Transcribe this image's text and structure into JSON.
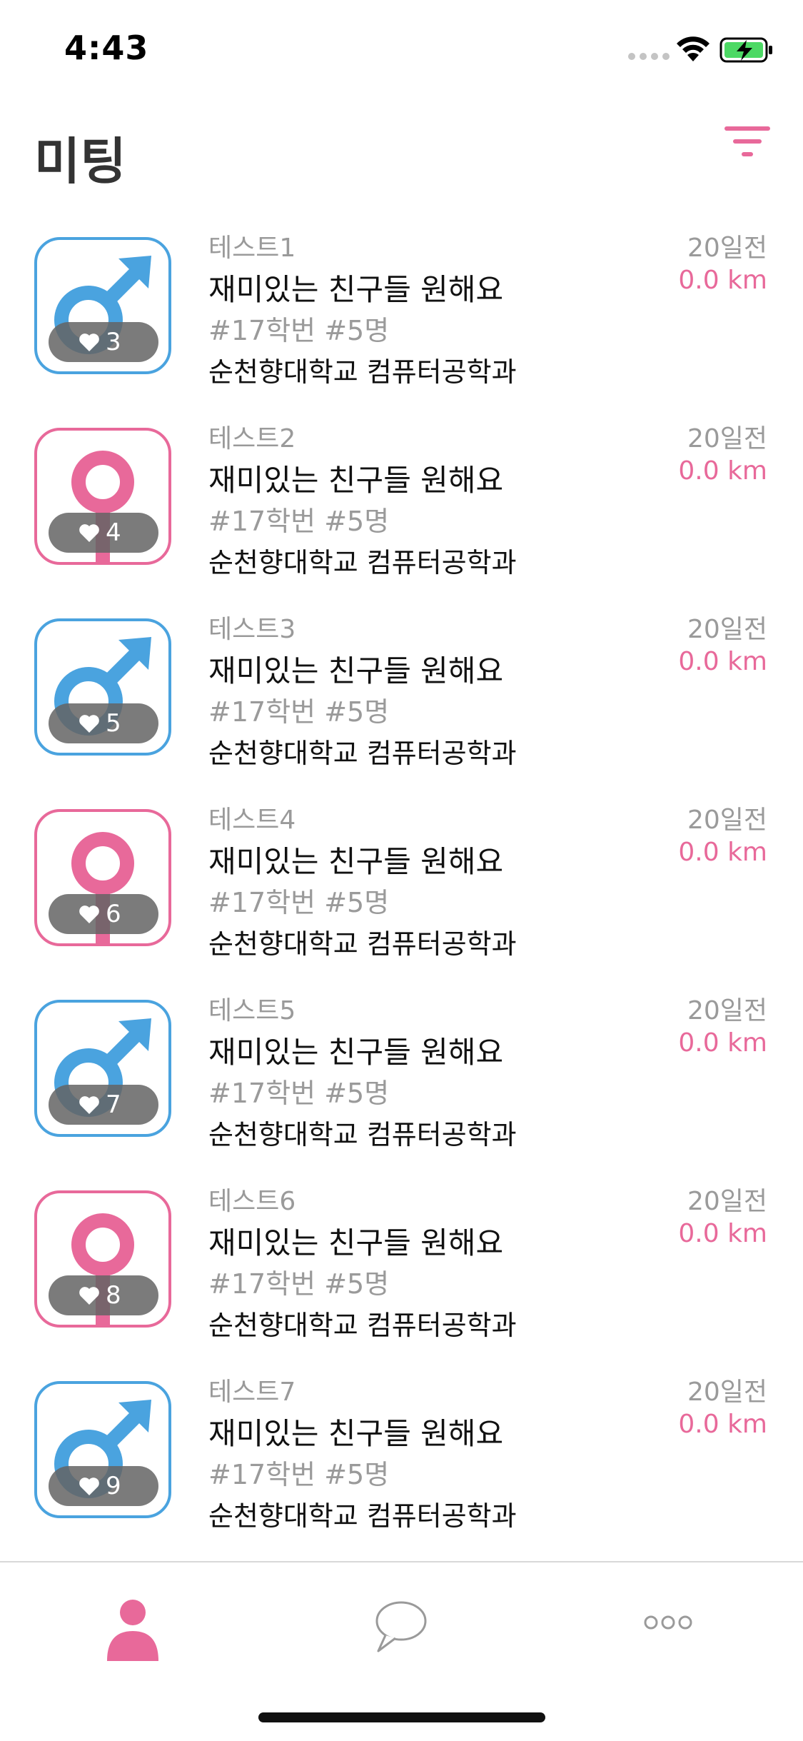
{
  "status": {
    "time": "4:43"
  },
  "header": {
    "title": "미팅"
  },
  "colors": {
    "accent": "#e8699a",
    "male": "#4aa3df",
    "female": "#e8699a"
  },
  "rows": [
    {
      "name": "테스트1",
      "title": "재미있는 친구들 원해요",
      "tags": "#17학번 #5명",
      "school": "순천향대학교 컴퓨터공학과",
      "time": "20일전",
      "distance": "0.0 km",
      "likes": "3",
      "gender": "male"
    },
    {
      "name": "테스트2",
      "title": "재미있는 친구들 원해요",
      "tags": "#17학번 #5명",
      "school": "순천향대학교 컴퓨터공학과",
      "time": "20일전",
      "distance": "0.0 km",
      "likes": "4",
      "gender": "female"
    },
    {
      "name": "테스트3",
      "title": "재미있는 친구들 원해요",
      "tags": "#17학번 #5명",
      "school": "순천향대학교 컴퓨터공학과",
      "time": "20일전",
      "distance": "0.0 km",
      "likes": "5",
      "gender": "male"
    },
    {
      "name": "테스트4",
      "title": "재미있는 친구들 원해요",
      "tags": "#17학번 #5명",
      "school": "순천향대학교 컴퓨터공학과",
      "time": "20일전",
      "distance": "0.0 km",
      "likes": "6",
      "gender": "female"
    },
    {
      "name": "테스트5",
      "title": "재미있는 친구들 원해요",
      "tags": "#17학번 #5명",
      "school": "순천향대학교 컴퓨터공학과",
      "time": "20일전",
      "distance": "0.0 km",
      "likes": "7",
      "gender": "male"
    },
    {
      "name": "테스트6",
      "title": "재미있는 친구들 원해요",
      "tags": "#17학번 #5명",
      "school": "순천향대학교 컴퓨터공학과",
      "time": "20일전",
      "distance": "0.0 km",
      "likes": "8",
      "gender": "female"
    },
    {
      "name": "테스트7",
      "title": "재미있는 친구들 원해요",
      "tags": "#17학번 #5명",
      "school": "순천향대학교 컴퓨터공학과",
      "time": "20일전",
      "distance": "0.0 km",
      "likes": "9",
      "gender": "male"
    }
  ],
  "tabs": [
    {
      "icon": "person-icon",
      "active": true
    },
    {
      "icon": "chat-bubble-icon",
      "active": false
    },
    {
      "icon": "more-dots-icon",
      "active": false
    }
  ]
}
